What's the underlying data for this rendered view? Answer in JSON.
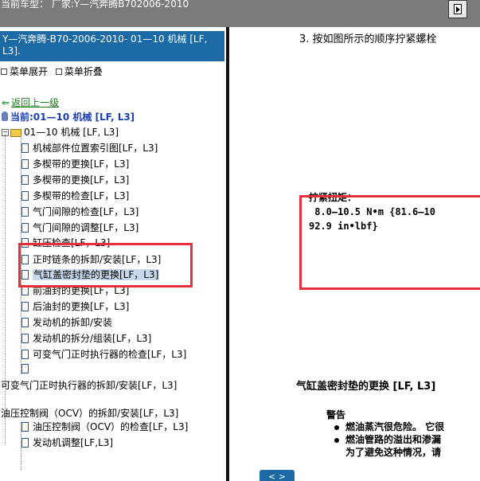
{
  "title_bar": {
    "title": "当前车型： 厂家:Y—汽奔腾B702006-2010"
  },
  "left_panel": {
    "header": "Y—汽奔腾-B70-2006-2010- 01—10 机械 [LF, L3].",
    "expand_label": "菜单展开",
    "collapse_label": "菜单折叠",
    "back_label": "返回上一级",
    "current_label": "当前:01—10 机械 [LF, L3]",
    "root_node": "01—10 机械 [LF, L3]",
    "items": [
      "机械部件位置索引图[LF，L3]",
      "多楔带的更换[LF，L3]",
      "多楔带的更换[LF，L3]",
      "多楔带的检查[LF，L3]",
      "气门间隙的检查[LF，L3]",
      "气门间隙的调整[LF，L3]",
      "缸压检查[LF，L3]",
      "正时链条的拆卸/安装[LF，L3]",
      "气缸盖密封垫的更换[LF，L3]",
      "前油封的更换[LF，L3]",
      "后油封的更换[LF，L3]",
      "发动机的拆卸/安装",
      "发动机的拆分/组装[LF，L3]",
      "可变气门正时执行器的检查[LF，L3]",
      ""
    ],
    "outer_items": [
      "可变气门正时执行器的拆卸/安装[LF，L3]",
      "油压控制阀（OCV）的拆卸/安装[LF，L3]"
    ],
    "sub_items": [
      "油压控制阀（OCV）的检查[LF，L3]",
      "发动机调整[LF,L3]"
    ],
    "selected_index": 8
  },
  "right_panel": {
    "step_text": "3. 按如图所示的顺序拧紧螺栓",
    "torque_title": "拧紧扭矩：",
    "torque_line1": " 8.0—10.5 N•m {81.6—10",
    "torque_line2": "92.9 in•lbf}",
    "section_title": "气缸盖密封垫的更换 [LF, L3]",
    "warning_title": "警告",
    "warning_1": "燃油蒸汽很危险。 它很",
    "warning_2": "燃油管路的溢出和渗漏",
    "warning_3": "为了避免这种情况，请",
    "nav_button": "< >"
  },
  "colors": {
    "header_bg": "#1b6aa5",
    "highlight_box": "#e8303a",
    "titlebar_bg": "#7b7b7b"
  }
}
